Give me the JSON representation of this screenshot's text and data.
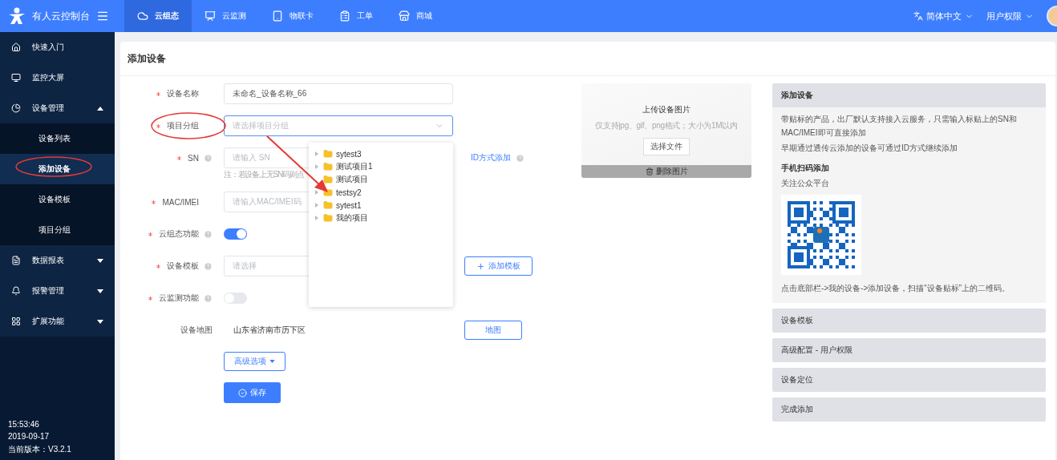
{
  "topbar": {
    "brand": "有人云控制台",
    "tabs": [
      {
        "label": "云组态",
        "selected": true
      },
      {
        "label": "云监测",
        "selected": false
      },
      {
        "label": "物联卡",
        "selected": false
      },
      {
        "label": "工单",
        "selected": false
      },
      {
        "label": "商城",
        "selected": false
      }
    ],
    "language": "简体中文",
    "user_menu": "用户权限"
  },
  "sidebar": {
    "items": [
      {
        "label": "快速入门",
        "kind": "link",
        "selected": false
      },
      {
        "label": "监控大屏",
        "kind": "link",
        "selected": false
      },
      {
        "label": "设备管理",
        "kind": "group",
        "expanded": true,
        "selected": false,
        "children": [
          {
            "label": "设备列表",
            "selected": false
          },
          {
            "label": "添加设备",
            "selected": true
          },
          {
            "label": "设备模板",
            "selected": false
          },
          {
            "label": "项目分组",
            "selected": false
          }
        ]
      },
      {
        "label": "数据报表",
        "kind": "group",
        "expanded": false,
        "selected": false
      },
      {
        "label": "报警管理",
        "kind": "group",
        "expanded": false,
        "selected": false
      },
      {
        "label": "扩展功能",
        "kind": "group",
        "expanded": false,
        "selected": false
      }
    ],
    "footer": [
      "15:53:46",
      "2019-09-17",
      "当前版本：V3.2.1"
    ]
  },
  "page": {
    "title": "添加设备"
  },
  "form": {
    "rows": [
      {
        "kind": "input",
        "label": "设备名称",
        "required": true,
        "help": false,
        "focused": false,
        "value": "未命名_设备名称_66"
      },
      {
        "kind": "select",
        "label": "项目分组",
        "required": true,
        "help": false,
        "focused": true,
        "placeholder": "请选择项目分组"
      },
      {
        "kind": "input",
        "label": "SN",
        "required": true,
        "help": true,
        "focused": false,
        "placeholder": "请输入 SN",
        "hint": "注：若设备上无SN码则点",
        "action": {
          "kind": "link",
          "label": "ID方式添加",
          "help": true
        }
      },
      {
        "kind": "input",
        "label": "MAC/IMEI",
        "required": true,
        "help": false,
        "focused": false,
        "placeholder": "请输入MAC/IMEI码"
      },
      {
        "kind": "switch",
        "label": "云组态功能",
        "required": true,
        "help": true,
        "on": true
      },
      {
        "kind": "input",
        "label": "设备模板",
        "required": true,
        "help": true,
        "focused": false,
        "placeholder": "请选择",
        "action": {
          "kind": "button",
          "label": "添加模板",
          "plus": true
        }
      },
      {
        "kind": "switch",
        "label": "云监测功能",
        "required": true,
        "help": true,
        "on": false
      },
      {
        "kind": "static",
        "label": "设备地图",
        "required": false,
        "help": false,
        "value": "山东省济南市历下区",
        "action": {
          "kind": "button",
          "label": "地图",
          "plus": false
        }
      }
    ],
    "advanced_button": "高级选项",
    "save_button": "保存"
  },
  "project_dropdown": {
    "items": [
      {
        "label": "sytest3",
        "has_children": true
      },
      {
        "label": "测试项目1",
        "has_children": true
      },
      {
        "label": "测试项目",
        "has_children": false
      },
      {
        "label": "testsy2",
        "has_children": true
      },
      {
        "label": "sytest1",
        "has_children": true
      },
      {
        "label": "我的项目",
        "has_children": true
      }
    ]
  },
  "upload": {
    "title": "上传设备图片",
    "hint": "仅支持jpg、gif、png格式；大小为1M以内",
    "choose_button": "选择文件",
    "delete_button": "删除图片"
  },
  "guide": {
    "sections": [
      {
        "title": "添加设备",
        "expanded": true,
        "blocks": [
          {
            "kind": "text",
            "text": "带贴标的产品，出厂默认支持接入云服务，只需输入标贴上的SN和MAC/IMEI即可直接添加"
          },
          {
            "kind": "text",
            "text": "早期通过透传云添加的设备可通过ID方式继续添加"
          },
          {
            "kind": "heading",
            "text": "手机扫码添加"
          },
          {
            "kind": "text",
            "text": "关注公众平台"
          },
          {
            "kind": "qr"
          },
          {
            "kind": "text",
            "text": "点击底部栏->我的设备->添加设备，扫描“设备贴标”上的二维码。"
          }
        ]
      },
      {
        "title": "设备模板",
        "expanded": false
      },
      {
        "title": "高级配置 - 用户权限",
        "expanded": false
      },
      {
        "title": "设备定位",
        "expanded": false
      },
      {
        "title": "完成添加",
        "expanded": false
      }
    ]
  }
}
